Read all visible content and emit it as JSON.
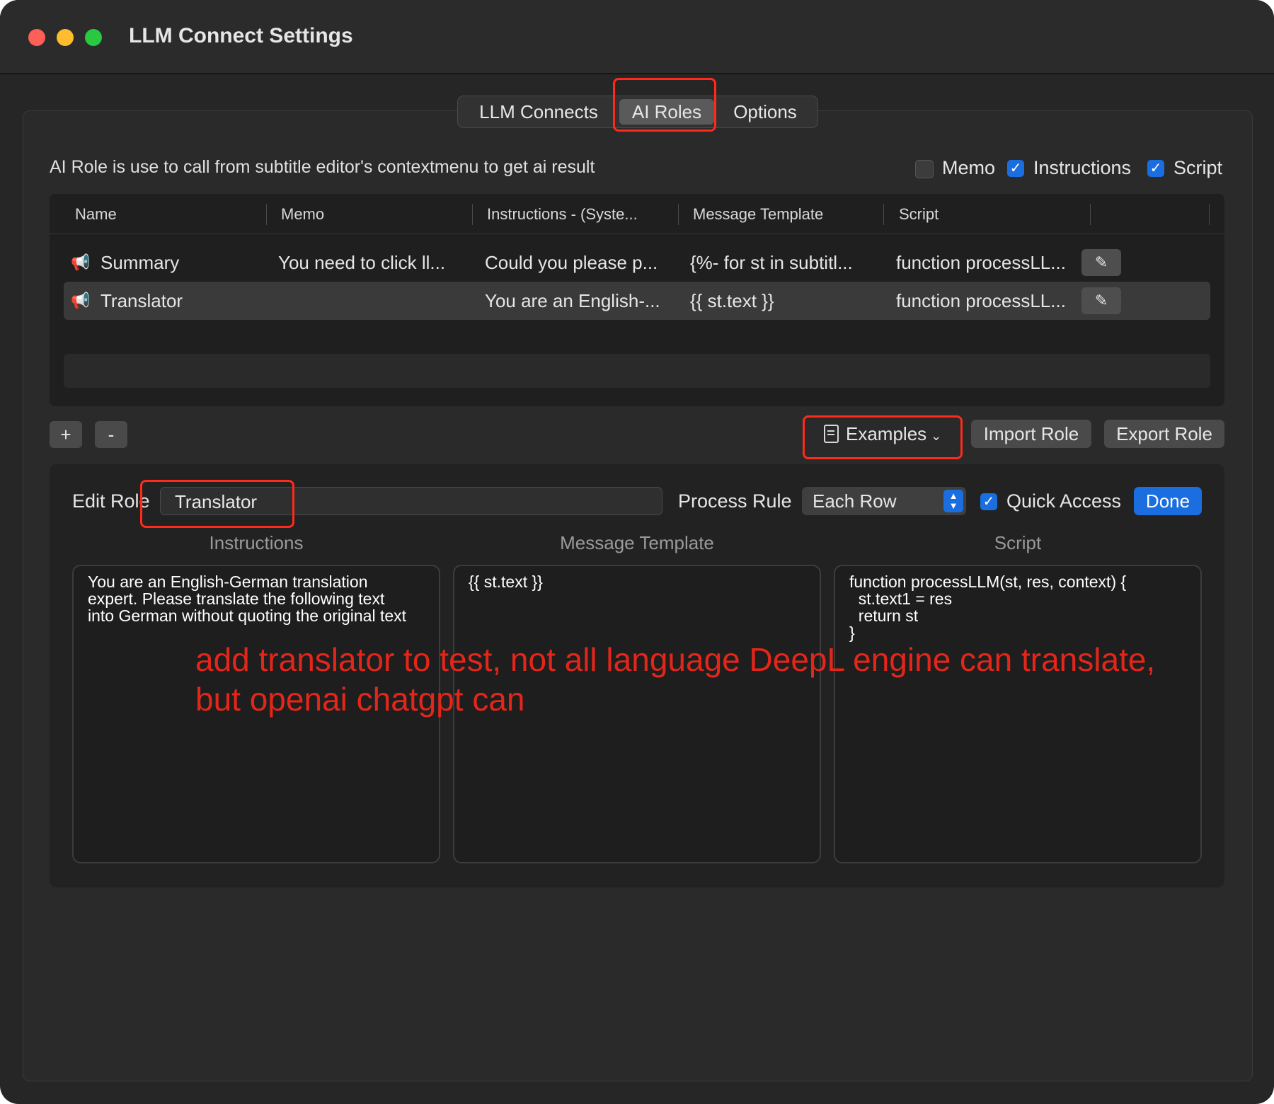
{
  "window": {
    "title": "LLM Connect Settings"
  },
  "tabs": [
    {
      "label": "LLM Connects",
      "active": false
    },
    {
      "label": "AI Roles",
      "active": true
    },
    {
      "label": "Options",
      "active": false
    }
  ],
  "description": "AI Role is use to call from subtitle editor's contextmenu to get ai result",
  "column_toggles": [
    {
      "label": "Memo",
      "checked": false
    },
    {
      "label": "Instructions",
      "checked": true
    },
    {
      "label": "Script",
      "checked": true
    }
  ],
  "table": {
    "headers": [
      "Name",
      "Memo",
      "Instructions - (Syste...",
      "Message Template",
      "Script"
    ],
    "rows": [
      {
        "name": "Summary",
        "memo": "You need to click ll...",
        "instructions": "Could you please p...",
        "template": "{%- for st in subtitl...",
        "script": "function processLL...",
        "selected": false
      },
      {
        "name": "Translator",
        "memo": "",
        "instructions": "You are an English-...",
        "template": "{{ st.text }}",
        "script": "function processLL...",
        "selected": true
      }
    ]
  },
  "toolbar": {
    "add_label": "+",
    "remove_label": "-",
    "examples_label": "Examples",
    "import_label": "Import Role",
    "export_label": "Export Role"
  },
  "editor": {
    "edit_role_label": "Edit Role",
    "role_name": "Translator",
    "process_rule_label": "Process Rule",
    "process_rule_value": "Each Row",
    "quick_access_label": "Quick Access",
    "quick_access_checked": true,
    "done_label": "Done",
    "instructions_title": "Instructions",
    "template_title": "Message Template",
    "script_title": "Script",
    "instructions_text": "You are an English-German translation\nexpert. Please translate the following text\ninto German without quoting the original text",
    "template_text": "{{ st.text }}",
    "script_text": "function processLLM(st, res, context) {\n  st.text1 = res\n  return st\n}"
  },
  "annotation": "add translator to test, not all language DeepL engine can translate, but openai chatgpt can",
  "colors": {
    "accent": "#1a6ee0",
    "highlight": "#ff2a1a",
    "annotation": "#e4261a"
  },
  "icons": {
    "row_icon": "speaker-icon",
    "edit_icon": "pencil-icon",
    "examples_icon": "document-icon"
  }
}
